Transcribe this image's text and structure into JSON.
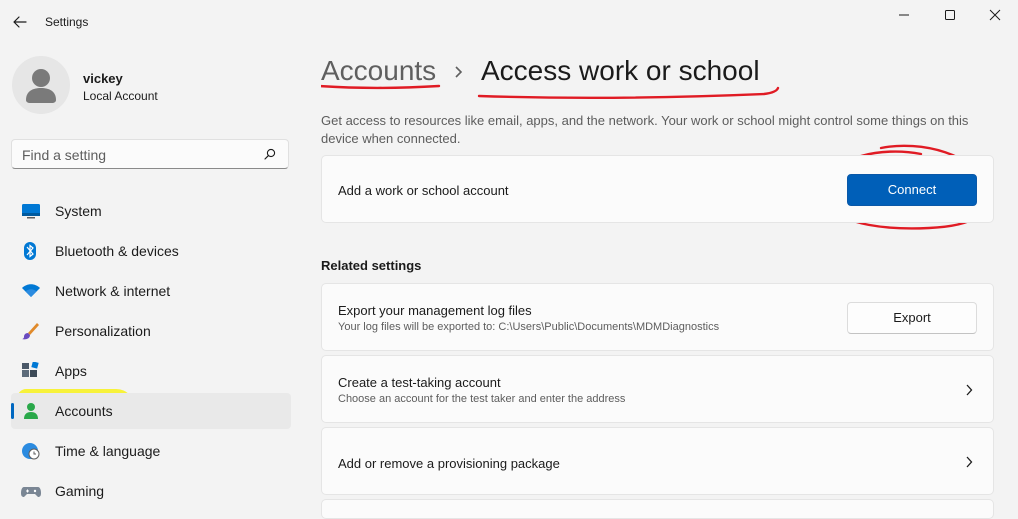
{
  "window": {
    "title": "Settings",
    "controls": {
      "minimize": "minimize-icon",
      "maximize": "maximize-icon",
      "close": "close-icon"
    }
  },
  "profile": {
    "name": "vickey",
    "account_type": "Local Account"
  },
  "search": {
    "placeholder": "Find a setting"
  },
  "sidebar": {
    "items": [
      {
        "label": "System",
        "icon": "system-icon"
      },
      {
        "label": "Bluetooth & devices",
        "icon": "bluetooth-icon"
      },
      {
        "label": "Network & internet",
        "icon": "wifi-icon"
      },
      {
        "label": "Personalization",
        "icon": "brush-icon"
      },
      {
        "label": "Apps",
        "icon": "apps-icon"
      },
      {
        "label": "Accounts",
        "icon": "accounts-icon",
        "active": true
      },
      {
        "label": "Time & language",
        "icon": "globe-clock-icon"
      },
      {
        "label": "Gaming",
        "icon": "gamepad-icon"
      }
    ]
  },
  "breadcrumb": {
    "parent": "Accounts",
    "current": "Access work or school"
  },
  "description": "Get access to resources like email, apps, and the network. Your work or school might control some things on this device when connected.",
  "connect_card": {
    "title": "Add a work or school account",
    "button": "Connect"
  },
  "related": {
    "heading": "Related settings",
    "items": [
      {
        "title": "Export your management log files",
        "subtitle": "Your log files will be exported to: C:\\Users\\Public\\Documents\\MDMDiagnostics",
        "button": "Export"
      },
      {
        "title": "Create a test-taking account",
        "subtitle": "Choose an account for the test taker and enter the address"
      },
      {
        "title": "Add or remove a provisioning package"
      }
    ]
  },
  "colors": {
    "accent": "#005fb8",
    "annotation": "#e01b24",
    "highlighter": "#f7f22a"
  }
}
